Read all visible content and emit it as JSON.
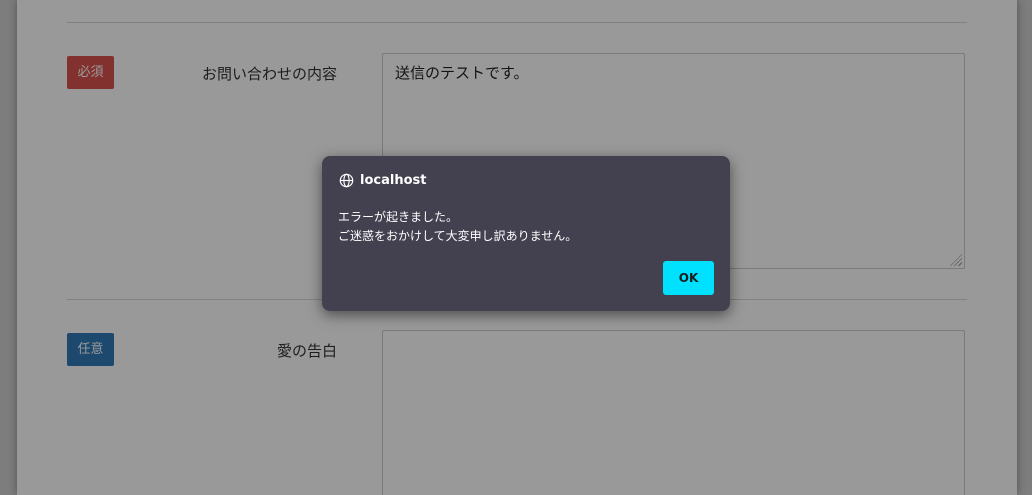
{
  "form": {
    "fields": [
      {
        "badge": "必須",
        "label": "お問い合わせの内容",
        "value": "送信のテストです。"
      },
      {
        "badge": "任意",
        "label": "愛の告白",
        "value": ""
      }
    ]
  },
  "dialog": {
    "origin": "localhost",
    "message_line1": "エラーが起きました。",
    "message_line2": "ご迷惑をおかけして大変申し訳ありません。",
    "ok_label": "OK"
  },
  "colors": {
    "required_badge": "#d9534f",
    "optional_badge": "#337ab7",
    "dialog_bg": "#434050",
    "ok_button": "#00e1ff"
  }
}
